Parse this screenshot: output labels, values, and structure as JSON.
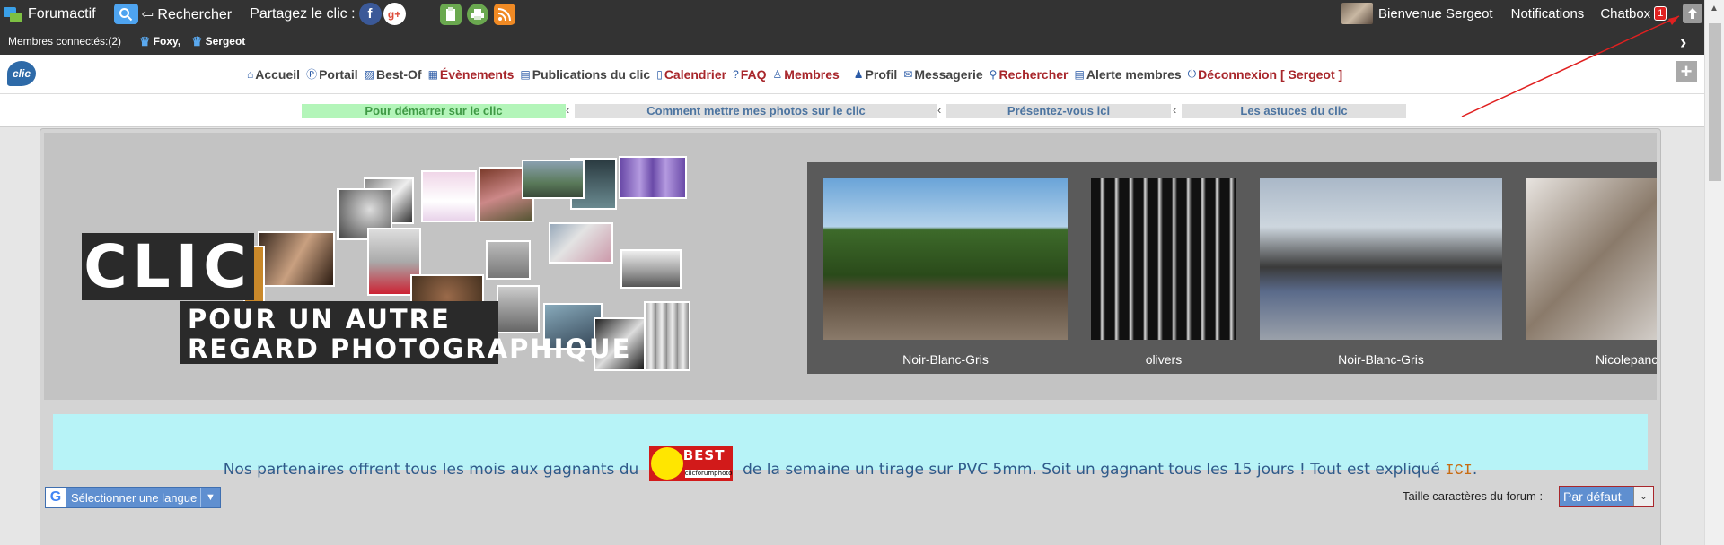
{
  "topbar": {
    "brand": "Forumactif",
    "search_label": "⇦ Rechercher",
    "share_label": "Partagez le clic :",
    "welcome": "Bienvenue Sergeot",
    "notifications": "Notifications",
    "chatbox": "Chatbox",
    "chatbox_count": "1"
  },
  "members_bar": {
    "label": "Membres connectés:(2)",
    "members": [
      "Foxy,",
      "Sergeot"
    ]
  },
  "nav": {
    "logo_text": "clic",
    "items": [
      {
        "label": "Accueil",
        "icon": "⌂"
      },
      {
        "label": "Portail",
        "icon": "Ⓟ"
      },
      {
        "label": "Best-Of",
        "icon": "▨"
      },
      {
        "label": "Évènements",
        "icon": "▦"
      },
      {
        "label": "Publications du clic",
        "icon": "▤"
      },
      {
        "label": "Calendrier",
        "icon": "▯"
      },
      {
        "label": "FAQ",
        "icon": "?"
      },
      {
        "label": "Membres",
        "icon": "♙"
      },
      {
        "label": "Profil",
        "icon": "♟"
      },
      {
        "label": "Messagerie",
        "icon": "✉"
      },
      {
        "label": "Rechercher",
        "icon": "⚲"
      },
      {
        "label": "Alerte membres",
        "icon": "▤"
      },
      {
        "label": "Déconnexion [ Sergeot ]",
        "icon": "⏻"
      }
    ]
  },
  "subtabs": [
    {
      "label": "Pour démarrer sur le clic"
    },
    {
      "label": "Comment mettre mes photos sur le clic"
    },
    {
      "label": "Présentez-vous ici"
    },
    {
      "label": "Les astuces du clic"
    }
  ],
  "banner": {
    "title": "CLIC",
    "tagline_1": "POUR UN AUTRE",
    "tagline_2": "REGARD PHOTOGRAPHIQUE"
  },
  "slider": {
    "captions": [
      "Noir-Blanc-Gris",
      "olivers",
      "Noir-Blanc-Gris",
      "Nicolepanc"
    ]
  },
  "partner": {
    "text_before": "Nos partenaires offrent tous les mois aux gagnants du",
    "logo_text": "BEST",
    "logo_sub": "clicforumphoto",
    "text_after": "de la semaine un tirage sur PVC 5mm. Soit un gagnant tous les 15 jours ! Tout est expliqué",
    "link": "ICI",
    "period": "."
  },
  "language": {
    "label": "Sélectionner une langue",
    "icon": "G"
  },
  "fontsize": {
    "label": "Taille caractères du forum :",
    "value": "Par défaut"
  },
  "colors": {
    "bar": "#333333",
    "nav_red": "#a8262b",
    "tab_active": "#b3f5b9",
    "partner_bg": "#b7f3f7"
  }
}
